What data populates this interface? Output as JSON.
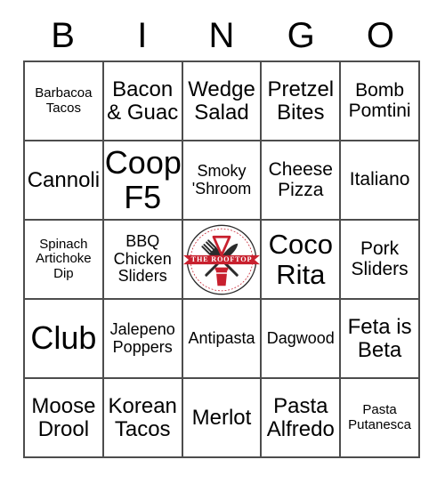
{
  "card": {
    "header_letters": [
      "B",
      "I",
      "N",
      "G",
      "O"
    ],
    "colors": {
      "grid_line": "#4d4d4d",
      "text": "#000000",
      "background": "#ffffff",
      "logo_red": "#c8202e",
      "logo_dark": "#2b2b2b"
    },
    "rows": [
      [
        {
          "text": "Barbacoa Tacos",
          "size": "fs-xs"
        },
        {
          "text": "Bacon & Guac",
          "size": "fs-l"
        },
        {
          "text": "Wedge Salad",
          "size": "fs-l"
        },
        {
          "text": "Pretzel Bites",
          "size": "fs-l"
        },
        {
          "text": "Bomb Pomtini",
          "size": "fs-m"
        }
      ],
      [
        {
          "text": "Cannoli",
          "size": "fs-l"
        },
        {
          "text": "Coop F5",
          "size": "fs-xxl"
        },
        {
          "text": "Smoky 'Shroom",
          "size": "fs-s"
        },
        {
          "text": "Cheese Pizza",
          "size": "fs-m"
        },
        {
          "text": "Italiano",
          "size": "fs-m"
        }
      ],
      [
        {
          "text": "Spinach Artichoke Dip",
          "size": "fs-xs"
        },
        {
          "text": "BBQ Chicken Sliders",
          "size": "fs-s"
        },
        {
          "logo": "the-rooftop-logo",
          "logo_text": "THE ROOFTOP"
        },
        {
          "text": "Coco Rita",
          "size": "fs-xl"
        },
        {
          "text": "Pork Sliders",
          "size": "fs-m"
        }
      ],
      [
        {
          "text": "Club",
          "size": "fs-xxl"
        },
        {
          "text": "Jalepeno Poppers",
          "size": "fs-s"
        },
        {
          "text": "Antipasta",
          "size": "fs-s"
        },
        {
          "text": "Dagwood",
          "size": "fs-s"
        },
        {
          "text": "Feta is Beta",
          "size": "fs-l"
        }
      ],
      [
        {
          "text": "Moose Drool",
          "size": "fs-l"
        },
        {
          "text": "Korean Tacos",
          "size": "fs-l"
        },
        {
          "text": "Merlot",
          "size": "fs-l"
        },
        {
          "text": "Pasta Alfredo",
          "size": "fs-l"
        },
        {
          "text": "Pasta Putanesca",
          "size": "fs-xs"
        }
      ]
    ]
  }
}
